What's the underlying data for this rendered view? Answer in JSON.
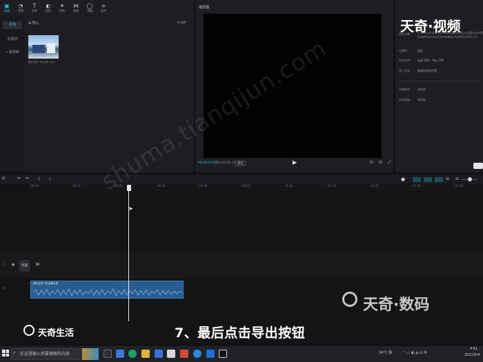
{
  "toolbar": {
    "items": [
      {
        "label": "媒体",
        "icon": "media-icon"
      },
      {
        "label": "音频",
        "icon": "audio-icon"
      },
      {
        "label": "文本",
        "icon": "text-icon"
      },
      {
        "label": "贴纸",
        "icon": "sticker-icon"
      },
      {
        "label": "特效",
        "icon": "effects-icon"
      },
      {
        "label": "转场",
        "icon": "transition-icon"
      },
      {
        "label": "滤镜",
        "icon": "filter-icon"
      },
      {
        "label": "调节",
        "icon": "adjust-icon"
      }
    ]
  },
  "sidenav": {
    "items": [
      "本地",
      "云素材",
      "• 素材库"
    ]
  },
  "media": {
    "import_label": "导入",
    "view_label": "☰ 排序",
    "file_name": "图片合成一段.合成.mp4"
  },
  "player": {
    "title": "播放器",
    "time_current": "00:00:13:00",
    "time_total": "00:00:31:25",
    "ratio_label": "适应"
  },
  "params": {
    "rows": [
      {
        "label": "保存位置:",
        "value": "C:/Users/Administrator/AppData/Local/JianyingPro/User Data/Projects/com.lveditor.draft/5月26日 (1)"
      },
      {
        "label": "分辨率:",
        "value": "适应"
      },
      {
        "label": "色彩空间:",
        "value": "标准 SDR - Rec.709"
      },
      {
        "label": "导入方式:",
        "value": "保留在原有位置"
      },
      {
        "label": "代理模式:",
        "value": "未开启"
      },
      {
        "label": "自由层级:",
        "value": "未开启"
      }
    ]
  },
  "timeline": {
    "ticks": [
      "00:00",
      "00:10",
      "00:20",
      "00:30",
      "00:40",
      "00:50",
      "01:00",
      "01:10",
      "01:20",
      "01:30",
      "01:40"
    ],
    "cover_label": "封面",
    "clip_name": "图片合成一段.画面合成"
  },
  "captions": {
    "subtitle": "7、最后点击导出按钮",
    "logo_left": "天奇生活",
    "brand_top": "天奇·视频",
    "brand_mid": "天奇·数码",
    "watermark": "shuma.tianqijun.com"
  },
  "taskbar": {
    "search_placeholder": "在这里输入你要搜索的内容",
    "weather": "24°C 阴",
    "time": "9:51",
    "date": "2022/5/4"
  },
  "colors": {
    "accent": "#25c3d3",
    "clip": "#2a5d8f"
  }
}
